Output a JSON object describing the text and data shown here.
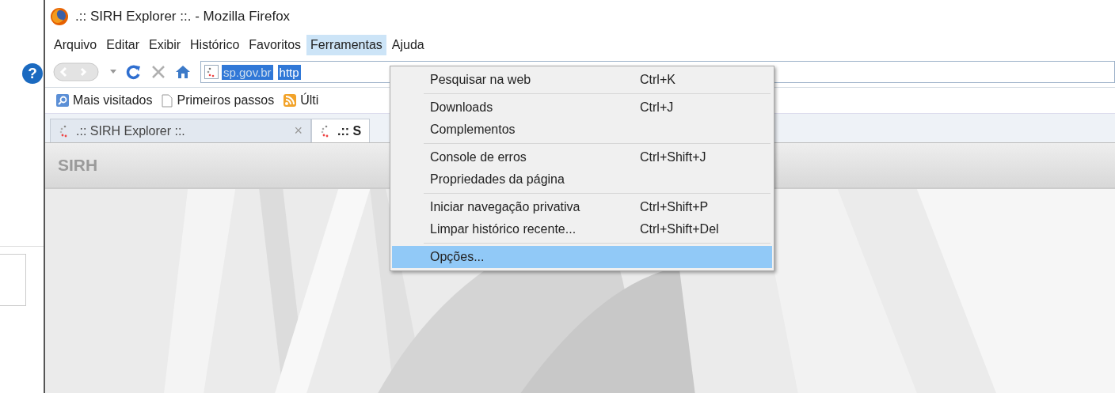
{
  "side_panel": {
    "help_glyph": "?"
  },
  "window": {
    "title": ".:: SIRH Explorer ::. - Mozilla Firefox"
  },
  "menu_bar": [
    {
      "label": "Arquivo",
      "selected": false
    },
    {
      "label": "Editar",
      "selected": false
    },
    {
      "label": "Exibir",
      "selected": false
    },
    {
      "label": "Histórico",
      "selected": false
    },
    {
      "label": "Favoritos",
      "selected": false
    },
    {
      "label": "Ferramentas",
      "selected": true
    },
    {
      "label": "Ajuda",
      "selected": false
    }
  ],
  "address_bar": {
    "selected_text": "sp.gov.br",
    "value": "http"
  },
  "bookmarks": [
    {
      "label": "Mais visitados",
      "kind": "search"
    },
    {
      "label": "Primeiros passos",
      "kind": "page"
    },
    {
      "label": "Últi",
      "kind": "feed"
    }
  ],
  "tabs": [
    {
      "label": ".:: SIRH Explorer ::.",
      "selected": false,
      "close": "×"
    },
    {
      "label": ".:: S",
      "selected": true
    }
  ],
  "page": {
    "header": "SIRH"
  },
  "tools_menu": [
    [
      {
        "label": "Pesquisar na web",
        "shortcut": "Ctrl+K",
        "selected": false
      }
    ],
    [
      {
        "label": "Downloads",
        "shortcut": "Ctrl+J",
        "selected": false
      },
      {
        "label": "Complementos",
        "selected": false
      }
    ],
    [
      {
        "label": "Console de erros",
        "shortcut": "Ctrl+Shift+J",
        "selected": false
      },
      {
        "label": "Propriedades da página",
        "selected": false
      }
    ],
    [
      {
        "label": "Iniciar navegação privativa",
        "shortcut": "Ctrl+Shift+P",
        "selected": false
      },
      {
        "label": "Limpar histórico recente...",
        "shortcut": "Ctrl+Shift+Del",
        "selected": false
      }
    ],
    [
      {
        "label": "Opções...",
        "selected": true
      }
    ]
  ]
}
